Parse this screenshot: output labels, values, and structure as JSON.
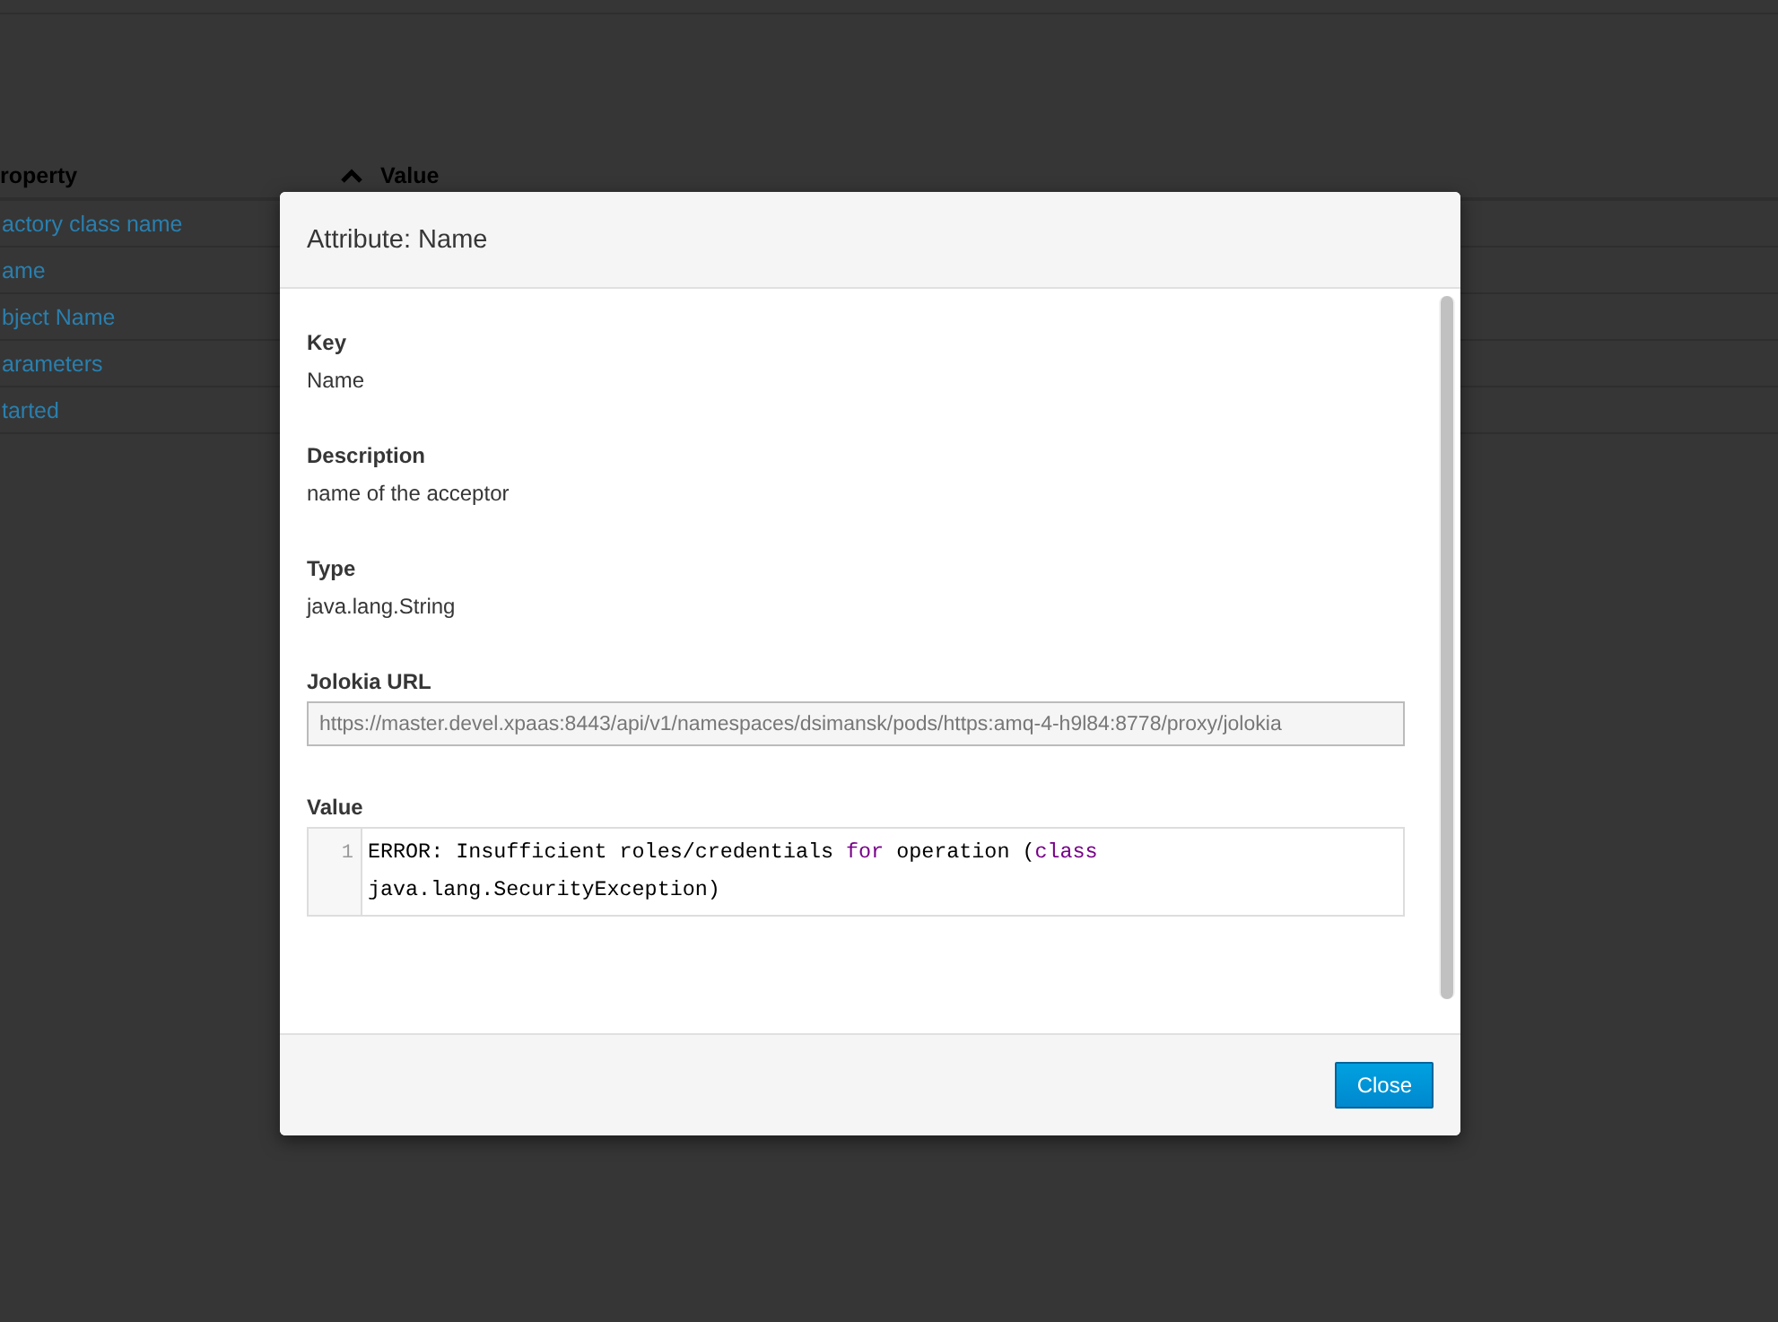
{
  "table": {
    "columns": [
      {
        "label": "roperty",
        "sorted": false
      },
      {
        "label": "Value",
        "sorted": true
      }
    ],
    "rows": [
      {
        "property": "actory class name"
      },
      {
        "property": "ame"
      },
      {
        "property": "bject Name"
      },
      {
        "property": "arameters"
      },
      {
        "property": "tarted"
      }
    ]
  },
  "dialog": {
    "title": "Attribute: Name",
    "fields": [
      {
        "kind": "text",
        "label": "Key",
        "value": "Name"
      },
      {
        "kind": "text",
        "label": "Description",
        "value": "name of the acceptor"
      },
      {
        "kind": "text",
        "label": "Type",
        "value": "java.lang.String"
      },
      {
        "kind": "input",
        "label": "Jolokia URL",
        "value": "https://master.devel.xpaas:8443/api/v1/namespaces/dsimansk/pods/https:amq-4-h9l84:8778/proxy/jolokia"
      },
      {
        "kind": "code",
        "label": "Value",
        "line_number": "1",
        "tokens": [
          {
            "kind": "plain",
            "text": "ERROR: Insufficient roles/credentials "
          },
          {
            "kind": "keyword",
            "text": "for"
          },
          {
            "kind": "plain",
            "text": " operation ("
          },
          {
            "kind": "keyword",
            "text": "class"
          },
          {
            "kind": "plain",
            "text": " java.lang.SecurityException)"
          }
        ]
      }
    ],
    "buttons": [
      {
        "label": "Close"
      }
    ]
  }
}
